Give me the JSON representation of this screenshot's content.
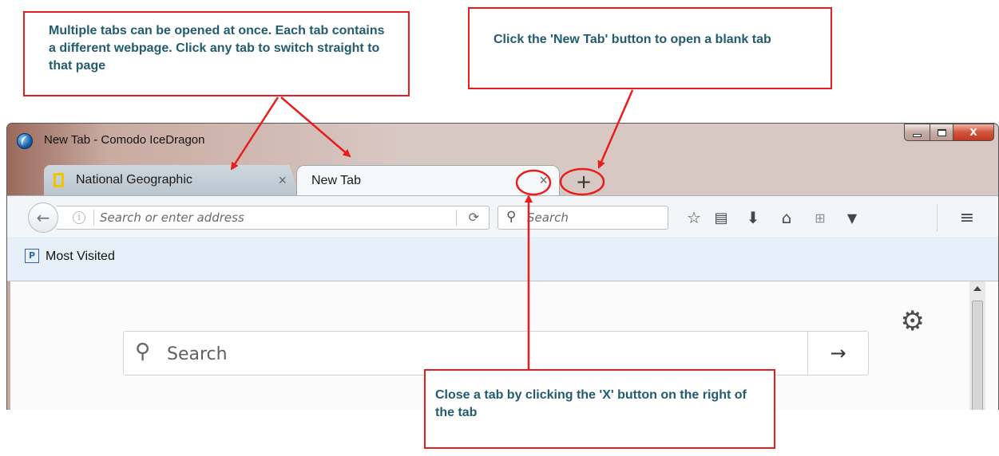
{
  "window": {
    "title": "New Tab - Comodo IceDragon",
    "controls": {
      "minimize": "",
      "maximize": "",
      "close": "X"
    }
  },
  "tabs": [
    {
      "label": "National Geographic",
      "close": "×",
      "icon": "natgeo-logo"
    },
    {
      "label": "New Tab",
      "close": "×",
      "active": true
    }
  ],
  "new_tab_button": "+",
  "navbar": {
    "url_placeholder": "Search or enter address",
    "search_placeholder": "Search",
    "icons": [
      "back-icon",
      "info-icon",
      "reload-icon",
      "search-icon",
      "star-icon",
      "reading-list-icon",
      "download-icon",
      "home-icon",
      "windows-icon",
      "pocket-icon",
      "menu-icon"
    ]
  },
  "bookmarks": {
    "most_visited": "Most Visited"
  },
  "content": {
    "search_placeholder": "Search",
    "go": "→"
  },
  "callouts": {
    "tabs": "Multiple tabs can be opened at once. Each tab contains a different webpage. Click any tab to switch straight to that page",
    "new_tab": "Click the 'New Tab' button to open a blank tab",
    "close_tab": "Close a tab by clicking the 'X' button on the right of the tab"
  },
  "colors": {
    "annotation": "#e81d1d",
    "callout_text": "#225c6e"
  }
}
